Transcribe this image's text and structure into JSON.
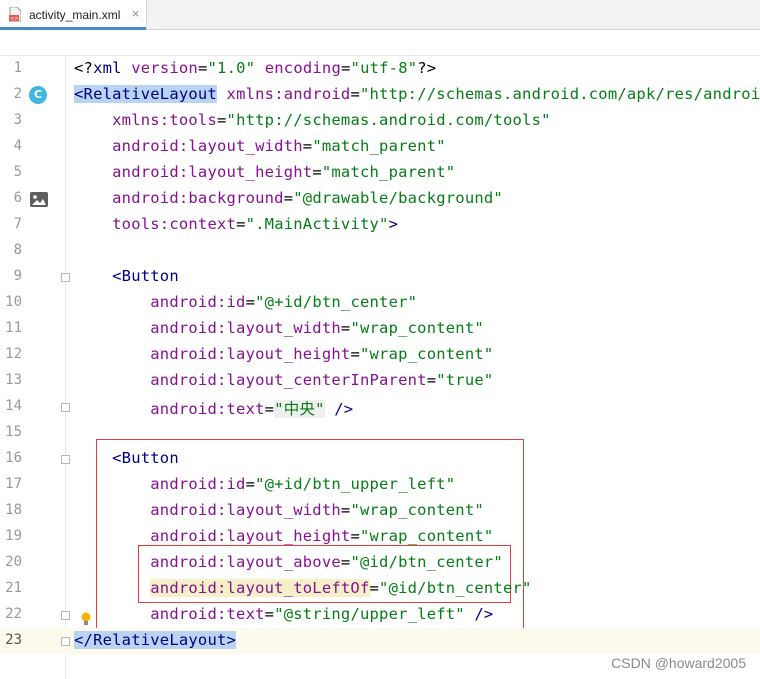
{
  "tab": {
    "label": "activity_main.xml",
    "close": "×"
  },
  "icons": {
    "file": "xml-file-icon",
    "class": "class-badge-icon",
    "image": "image-preview-icon",
    "bulb": "lightbulb-icon"
  },
  "gutter_badge_letter": "C",
  "lines": [
    {
      "n": "1",
      "tokens": [
        [
          "t-bracket",
          "<?"
        ],
        [
          "t-tag",
          "xml "
        ],
        [
          "t-attr",
          "version"
        ],
        [
          "t-plain",
          "="
        ],
        [
          "t-val",
          "\"1.0\""
        ],
        [
          "t-plain",
          " "
        ],
        [
          "t-attr",
          "encoding"
        ],
        [
          "t-plain",
          "="
        ],
        [
          "t-val",
          "\"utf-8\""
        ],
        [
          "t-bracket",
          "?>"
        ]
      ]
    },
    {
      "n": "2",
      "tokens": [
        [
          "t-tag hl-blue",
          "<RelativeLayout"
        ],
        [
          "t-plain",
          " "
        ],
        [
          "t-ns",
          "xmlns:android"
        ],
        [
          "t-plain",
          "="
        ],
        [
          "t-val",
          "\"http://schemas.android.com/apk/res/android\""
        ]
      ]
    },
    {
      "n": "3",
      "tokens": [
        [
          "t-plain",
          "    "
        ],
        [
          "t-ns",
          "xmlns:tools"
        ],
        [
          "t-plain",
          "="
        ],
        [
          "t-val",
          "\"http://schemas.android.com/tools\""
        ]
      ]
    },
    {
      "n": "4",
      "tokens": [
        [
          "t-plain",
          "    "
        ],
        [
          "t-ns",
          "android:layout_width"
        ],
        [
          "t-plain",
          "="
        ],
        [
          "t-val",
          "\"match_parent\""
        ]
      ]
    },
    {
      "n": "5",
      "tokens": [
        [
          "t-plain",
          "    "
        ],
        [
          "t-ns",
          "android:layout_height"
        ],
        [
          "t-plain",
          "="
        ],
        [
          "t-val",
          "\"match_parent\""
        ]
      ]
    },
    {
      "n": "6",
      "tokens": [
        [
          "t-plain",
          "    "
        ],
        [
          "t-ns",
          "android:background"
        ],
        [
          "t-plain",
          "="
        ],
        [
          "t-val",
          "\"@drawable/background\""
        ]
      ]
    },
    {
      "n": "7",
      "tokens": [
        [
          "t-plain",
          "    "
        ],
        [
          "t-ns",
          "tools:context"
        ],
        [
          "t-plain",
          "="
        ],
        [
          "t-val",
          "\".MainActivity\""
        ],
        [
          "t-tag",
          ">"
        ]
      ]
    },
    {
      "n": "8",
      "tokens": []
    },
    {
      "n": "9",
      "tokens": [
        [
          "t-plain",
          "    "
        ],
        [
          "t-tag",
          "<Button"
        ]
      ]
    },
    {
      "n": "10",
      "tokens": [
        [
          "t-plain",
          "        "
        ],
        [
          "t-ns",
          "android:id"
        ],
        [
          "t-plain",
          "="
        ],
        [
          "t-val",
          "\"@+id/btn_center\""
        ]
      ]
    },
    {
      "n": "11",
      "tokens": [
        [
          "t-plain",
          "        "
        ],
        [
          "t-ns",
          "android:layout_width"
        ],
        [
          "t-plain",
          "="
        ],
        [
          "t-val",
          "\"wrap_content\""
        ]
      ]
    },
    {
      "n": "12",
      "tokens": [
        [
          "t-plain",
          "        "
        ],
        [
          "t-ns",
          "android:layout_height"
        ],
        [
          "t-plain",
          "="
        ],
        [
          "t-val",
          "\"wrap_content\""
        ]
      ]
    },
    {
      "n": "13",
      "tokens": [
        [
          "t-plain",
          "        "
        ],
        [
          "t-ns",
          "android:layout_centerInParent"
        ],
        [
          "t-plain",
          "="
        ],
        [
          "t-val",
          "\"true\""
        ]
      ]
    },
    {
      "n": "14",
      "tokens": [
        [
          "t-plain",
          "        "
        ],
        [
          "t-ns",
          "android:text"
        ],
        [
          "t-plain",
          "="
        ],
        [
          "t-val hl-gray",
          "\"中央\""
        ],
        [
          "t-tag",
          " />"
        ]
      ]
    },
    {
      "n": "15",
      "tokens": []
    },
    {
      "n": "16",
      "tokens": [
        [
          "t-plain",
          "    "
        ],
        [
          "t-tag",
          "<Button"
        ]
      ]
    },
    {
      "n": "17",
      "tokens": [
        [
          "t-plain",
          "        "
        ],
        [
          "t-ns",
          "android:id"
        ],
        [
          "t-plain",
          "="
        ],
        [
          "t-val",
          "\"@+id/btn_upper_left\""
        ]
      ]
    },
    {
      "n": "18",
      "tokens": [
        [
          "t-plain",
          "        "
        ],
        [
          "t-ns",
          "android:layout_width"
        ],
        [
          "t-plain",
          "="
        ],
        [
          "t-val",
          "\"wrap_content\""
        ]
      ]
    },
    {
      "n": "19",
      "tokens": [
        [
          "t-plain",
          "        "
        ],
        [
          "t-ns",
          "android:layout_height"
        ],
        [
          "t-plain",
          "="
        ],
        [
          "t-val",
          "\"wrap_content\""
        ]
      ]
    },
    {
      "n": "20",
      "tokens": [
        [
          "t-plain",
          "        "
        ],
        [
          "t-ns",
          "android:layout_above"
        ],
        [
          "t-plain",
          "="
        ],
        [
          "t-val",
          "\"@id/btn_center\""
        ]
      ]
    },
    {
      "n": "21",
      "tokens": [
        [
          "t-plain",
          "        "
        ],
        [
          "t-ns hl-yellow",
          "android:layout_toLeftOf"
        ],
        [
          "t-plain",
          "="
        ],
        [
          "t-val",
          "\"@id/btn_center\""
        ]
      ]
    },
    {
      "n": "22",
      "tokens": [
        [
          "t-plain",
          "        "
        ],
        [
          "t-ns",
          "android:text"
        ],
        [
          "t-plain",
          "="
        ],
        [
          "t-val",
          "\"@string/upper_left\""
        ],
        [
          "t-tag",
          " />"
        ]
      ]
    },
    {
      "n": "23",
      "tokens": [
        [
          "t-tag hl-blue",
          "</RelativeLayout>"
        ]
      ]
    }
  ],
  "watermark": "CSDN @howard2005"
}
